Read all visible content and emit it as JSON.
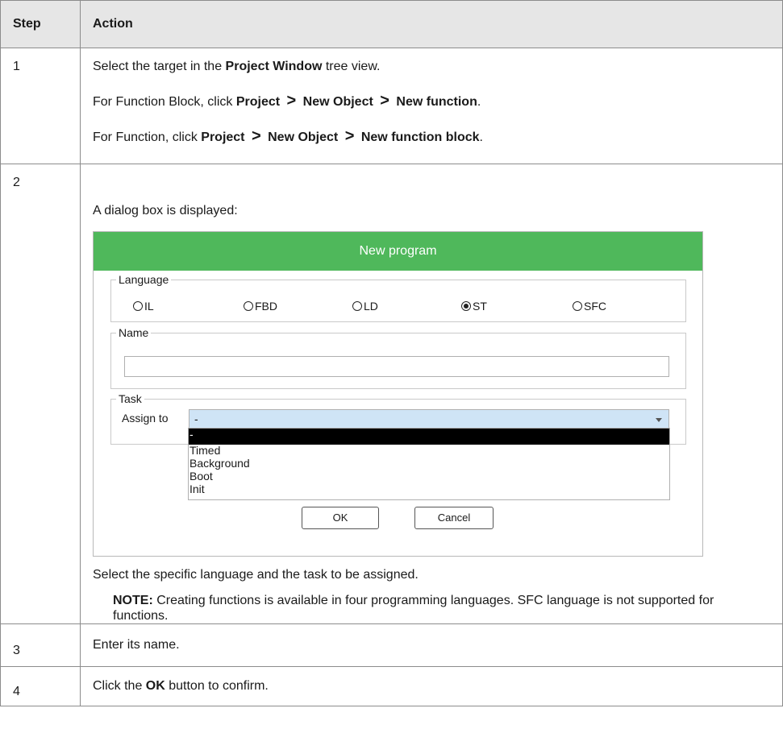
{
  "table": {
    "header": {
      "step": "Step",
      "action": "Action"
    },
    "row1": {
      "step": "1",
      "line1_pre": "Select the target in the ",
      "line1_bold": "Project Window",
      "line1_post": " tree view.",
      "line2_pre": "For Function Block, click ",
      "line2_bold1": "Project",
      "line2_sep1": ">",
      "line2_bold2": "New Object",
      "line2_sep2": ">",
      "line2_bold3": "New function",
      "line2_post": ".",
      "line3_pre": "For Function, click ",
      "line3_bold1": "Project",
      "line3_sep1": ">",
      "line3_bold2": "New Object",
      "line3_sep2": ">",
      "line3_bold3": "New function block",
      "line3_post": "."
    },
    "row2": {
      "step": "2",
      "intro": "A dialog box is displayed:",
      "after": "Select the specific language and the task to be assigned.",
      "note_label": "NOTE:",
      "note_text": " Creating functions is available in four programming languages. SFC language is not supported for functions."
    },
    "row3": {
      "step": "3",
      "text": "Enter its name."
    },
    "row4": {
      "step": "4",
      "pre": "Click the ",
      "bold": "OK",
      "post": " button to confirm."
    }
  },
  "dialog": {
    "title": "New program",
    "title_color": "#4fb85b",
    "language_legend": "Language",
    "languages": [
      {
        "label": "IL",
        "selected": false
      },
      {
        "label": "FBD",
        "selected": false
      },
      {
        "label": "LD",
        "selected": false
      },
      {
        "label": "ST",
        "selected": true
      },
      {
        "label": "SFC",
        "selected": false
      }
    ],
    "name_legend": "Name",
    "name_value": "",
    "task_legend": "Task",
    "assign_label": "Assign to",
    "assign_value": "-",
    "options": [
      "-",
      "Timed",
      "Background",
      "Boot",
      "Init"
    ],
    "ok_label": "OK",
    "cancel_label": "Cancel"
  }
}
